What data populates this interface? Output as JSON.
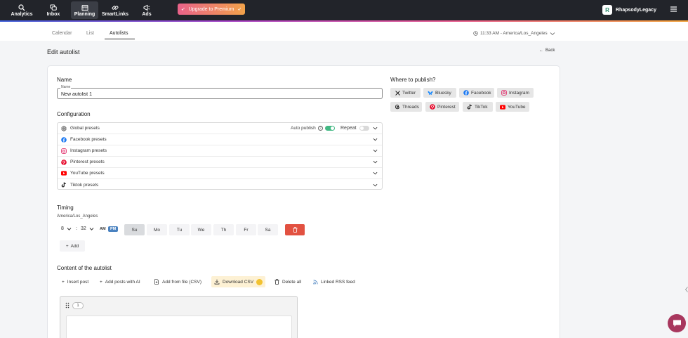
{
  "nav": {
    "items": [
      {
        "label": "Analytics",
        "icon": "search-chart-icon"
      },
      {
        "label": "Inbox",
        "icon": "chat-icon"
      },
      {
        "label": "Planning",
        "icon": "calendar-icon"
      },
      {
        "label": "SmartLinks",
        "icon": "link-icon"
      },
      {
        "label": "Ads",
        "icon": "megaphone-icon"
      }
    ],
    "premium_label": "Upgrade to Premium",
    "user_name": "RhapsodyLegacy",
    "user_initial": "R"
  },
  "subnav": {
    "tabs": [
      "Calendar",
      "List",
      "Autolists"
    ],
    "active_tab": "Autolists",
    "timezone_display": "11:33 AM - America/Los_Angeles"
  },
  "page": {
    "title": "Edit autolist",
    "back_label": "Back"
  },
  "name_section": {
    "title": "Name",
    "field_legend": "Name",
    "field_value": "New autolist 1"
  },
  "configuration": {
    "title": "Configuration",
    "auto_publish_label": "Auto publish",
    "auto_publish_on": true,
    "repeat_label": "Repeat",
    "repeat_on": false,
    "rows": [
      {
        "label": "Global presets",
        "icon": "gear-icon"
      },
      {
        "label": "Facebook presets",
        "icon": "facebook-icon"
      },
      {
        "label": "Instagram presets",
        "icon": "instagram-icon"
      },
      {
        "label": "Pinterest presets",
        "icon": "pinterest-icon"
      },
      {
        "label": "YouTube presets",
        "icon": "youtube-icon"
      },
      {
        "label": "Tiktok presets",
        "icon": "tiktok-icon"
      }
    ]
  },
  "timing": {
    "title": "Timing",
    "timezone": "America/Los_Angeles",
    "hour": "8",
    "minute": "32",
    "am_label": "AM",
    "pm_label": "PM",
    "selected_period": "PM",
    "days": [
      "Su",
      "Mo",
      "Tu",
      "We",
      "Th",
      "Fr",
      "Sa"
    ],
    "selected_day": "Su",
    "add_label": "Add"
  },
  "content": {
    "title": "Content of the autolist",
    "actions": [
      {
        "label": "Insert post",
        "icon": "plus-icon"
      },
      {
        "label": "Add posts with AI",
        "icon": "plus-icon"
      },
      {
        "label": "Add from file (CSV)",
        "icon": "file-add-icon"
      },
      {
        "label": "Download CSV",
        "icon": "download-icon"
      },
      {
        "label": "Delete all",
        "icon": "trash-icon"
      },
      {
        "label": "Linked RSS feed",
        "icon": "rss-icon"
      }
    ],
    "post_index": "1"
  },
  "publish": {
    "title": "Where to publish?",
    "platforms": [
      {
        "label": "Twitter",
        "icon": "x-icon",
        "color": "#000000"
      },
      {
        "label": "Bluesky",
        "icon": "butterfly-icon",
        "color": "#1185fe"
      },
      {
        "label": "Facebook",
        "icon": "facebook-icon",
        "color": "#1877f2"
      },
      {
        "label": "Instagram",
        "icon": "instagram-icon",
        "color": "#e1306c"
      },
      {
        "label": "Threads",
        "icon": "threads-icon",
        "color": "#000000"
      },
      {
        "label": "Pinterest",
        "icon": "pinterest-icon",
        "color": "#e60023"
      },
      {
        "label": "TikTok",
        "icon": "tiktok-icon",
        "color": "#000000"
      },
      {
        "label": "YouTube",
        "icon": "youtube-icon",
        "color": "#ff0000"
      }
    ]
  },
  "colors": {
    "nav_bg": "#22242a",
    "accent_green": "#42b883",
    "delete_red": "#e25141",
    "pm_blue": "#4a82c0",
    "chat_bubble": "#a8375e"
  }
}
